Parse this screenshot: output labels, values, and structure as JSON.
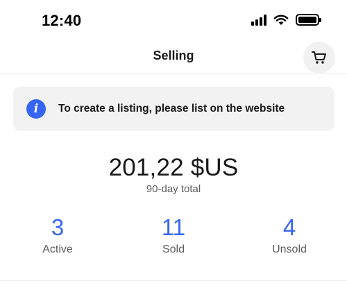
{
  "status_bar": {
    "time": "12:40",
    "icons": [
      "cellular-signal-icon",
      "wifi-icon",
      "battery-icon"
    ]
  },
  "header": {
    "title": "Selling",
    "cart_icon": "cart-icon"
  },
  "info_banner": {
    "icon": "info-icon",
    "icon_glyph": "i",
    "text": "To create a listing, please list on the website"
  },
  "summary": {
    "total_amount": "201,22 $US",
    "total_label": "90-day total"
  },
  "stats": [
    {
      "value": "3",
      "label": "Active"
    },
    {
      "value": "11",
      "label": "Sold"
    },
    {
      "value": "4",
      "label": "Unsold"
    }
  ],
  "colors": {
    "accent": "#3665f3",
    "banner_bg": "#f2f2f2",
    "text_primary": "#191919",
    "text_secondary": "#5b5b5b"
  }
}
